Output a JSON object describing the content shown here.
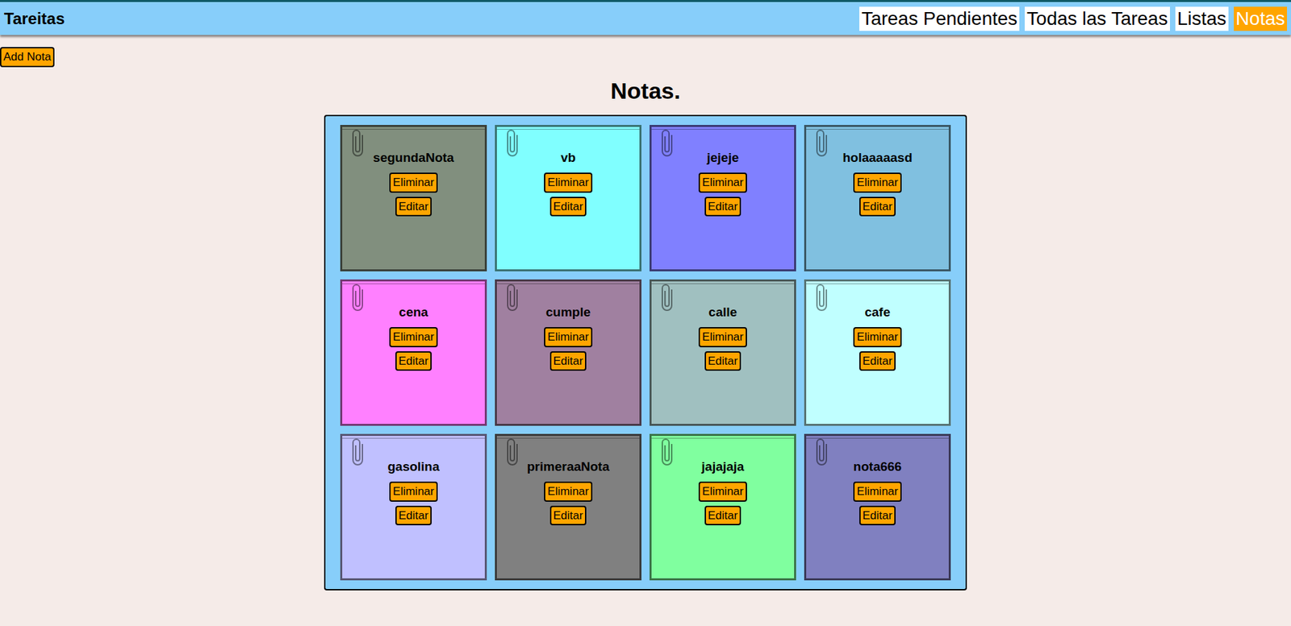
{
  "header": {
    "title": "Tareitas"
  },
  "nav": [
    {
      "label": "Tareas Pendientes",
      "selected": false
    },
    {
      "label": "Todas las Tareas",
      "selected": false
    },
    {
      "label": "Listas",
      "selected": false
    },
    {
      "label": "Notas",
      "selected": true
    }
  ],
  "add_button": "Add Nota",
  "heading": "Notas.",
  "note_buttons": {
    "delete": "Eliminar",
    "edit": "Editar"
  },
  "notes": [
    {
      "title": "segundaNota",
      "color": "#818f7e"
    },
    {
      "title": "vb",
      "color": "#80ffff"
    },
    {
      "title": "jejeje",
      "color": "#8080ff"
    },
    {
      "title": "holaaaaasd",
      "color": "#80c0e0"
    },
    {
      "title": "cena",
      "color": "#ff80ff"
    },
    {
      "title": "cumple",
      "color": "#a080a0"
    },
    {
      "title": "calle",
      "color": "#a0c0c0"
    },
    {
      "title": "cafe",
      "color": "#c0ffff"
    },
    {
      "title": "gasolina",
      "color": "#c0c0ff"
    },
    {
      "title": "primeraaNota",
      "color": "#808080"
    },
    {
      "title": "jajajaja",
      "color": "#80ff9f"
    },
    {
      "title": "nota666",
      "color": "#8080c0"
    }
  ]
}
